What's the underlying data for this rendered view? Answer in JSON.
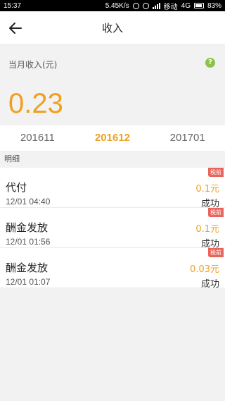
{
  "status_bar": {
    "time": "15:37",
    "speed": "5.45K/s",
    "carrier": "移动",
    "network": "4G",
    "battery": "83%"
  },
  "header": {
    "title": "收入"
  },
  "summary": {
    "label": "当月收入(元)",
    "amount": "0.23",
    "accent_color": "#f0a020"
  },
  "month_tabs": [
    "201611",
    "201612",
    "201701"
  ],
  "active_month": "201612",
  "section_label": "明细",
  "items": [
    {
      "name": "代付",
      "time": "12/01 04:40",
      "value": "0.1元",
      "status": "成功",
      "tag": "税前"
    },
    {
      "name": "酬金发放",
      "time": "12/01 01:56",
      "value": "0.1元",
      "status": "成功",
      "tag": "税前"
    },
    {
      "name": "酬金发放",
      "time": "12/01 01:07",
      "value": "0.03元",
      "status": "成功",
      "tag": "税前"
    }
  ]
}
